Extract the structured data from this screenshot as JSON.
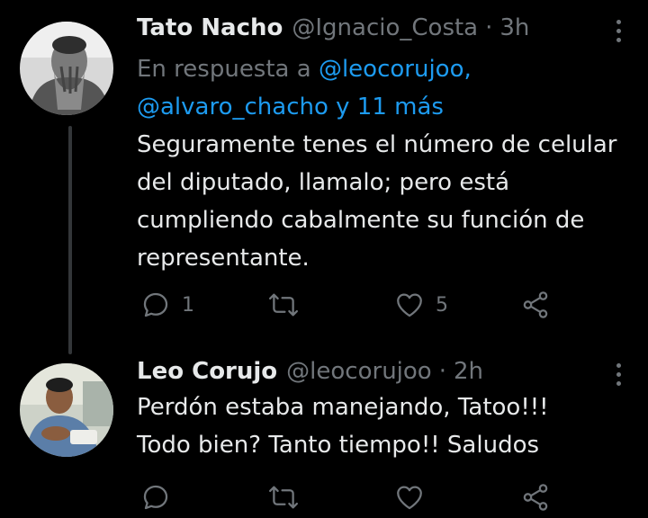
{
  "tweets": [
    {
      "name": "Tato Nacho",
      "handle": "@Ignacio_Costa",
      "separator": "·",
      "time": "3h",
      "reply_prefix": "En respuesta a",
      "reply_mention_1": "@leocorujoo,",
      "reply_mention_2": "@alvaro_chacho",
      "reply_and": "y 11 más",
      "body": [
        "Seguramente tenes el número de celular",
        "del diputado, llamalo; pero está",
        "cumpliendo cabalmente su función de",
        "representante."
      ],
      "reply_count": "1",
      "retweet_count": "",
      "like_count": "5",
      "avatar_icon": "person-photo"
    },
    {
      "name": "Leo Corujo",
      "handle": "@leocorujoo",
      "separator": "·",
      "time": "2h",
      "body": [
        "Perdón estaba manejando,  Tatoo!!!",
        "Todo bien? Tanto tiempo!! Saludos"
      ],
      "reply_count": "",
      "retweet_count": "",
      "like_count": "",
      "avatar_icon": "person-photo"
    }
  ],
  "colors": {
    "background": "#000000",
    "text": "#e7e9ea",
    "muted": "#71767b",
    "link": "#1d9bf0"
  }
}
